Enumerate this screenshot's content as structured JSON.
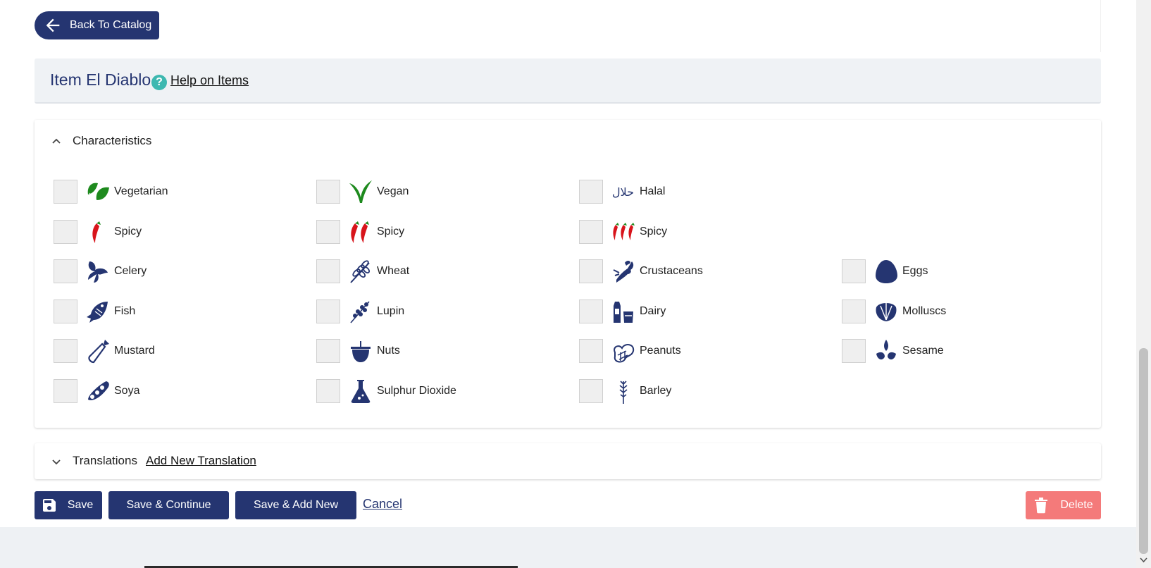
{
  "top": {
    "back_label": "Back To Catalog"
  },
  "header": {
    "title": "Item El Diablo",
    "help_label": "Help on Items"
  },
  "characteristics": {
    "section_label": "Characteristics",
    "rows": [
      [
        {
          "label": "Vegetarian",
          "icon": "leaf-icon"
        },
        {
          "label": "Vegan",
          "icon": "vegan-sprout-icon"
        },
        {
          "label": "Halal",
          "icon": "halal-icon"
        },
        null
      ],
      [
        {
          "label": "Spicy",
          "icon": "chili-1-icon"
        },
        {
          "label": "Spicy",
          "icon": "chili-2-icon"
        },
        {
          "label": "Spicy",
          "icon": "chili-3-icon"
        },
        null
      ],
      [
        {
          "label": "Celery",
          "icon": "celery-icon"
        },
        {
          "label": "Wheat",
          "icon": "wheat-icon"
        },
        {
          "label": "Crustaceans",
          "icon": "lobster-icon"
        },
        {
          "label": "Eggs",
          "icon": "egg-icon"
        }
      ],
      [
        {
          "label": "Fish",
          "icon": "fish-icon"
        },
        {
          "label": "Lupin",
          "icon": "lupin-icon"
        },
        {
          "label": "Dairy",
          "icon": "milk-icon"
        },
        {
          "label": "Molluscs",
          "icon": "shell-icon"
        }
      ],
      [
        {
          "label": "Mustard",
          "icon": "mustard-bottle-icon"
        },
        {
          "label": "Nuts",
          "icon": "nut-icon"
        },
        {
          "label": "Peanuts",
          "icon": "peanut-icon"
        },
        {
          "label": "Sesame",
          "icon": "sesame-icon"
        }
      ],
      [
        {
          "label": "Soya",
          "icon": "soy-bean-icon"
        },
        {
          "label": "Sulphur Dioxide",
          "icon": "flask-icon"
        },
        {
          "label": "Barley",
          "icon": "barley-icon"
        },
        null
      ]
    ]
  },
  "translations": {
    "label": "Translations",
    "add_label": "Add New Translation"
  },
  "actions": {
    "save_label": "Save",
    "save_continue_label": "Save & Continue",
    "save_add_label": "Save & Add New",
    "cancel_label": "Cancel",
    "delete_label": "Delete"
  },
  "colors": {
    "primary": "#253571",
    "danger": "#f47a7a",
    "help": "#3db8b0",
    "green": "#1e8a1e",
    "red": "#d8141b"
  }
}
